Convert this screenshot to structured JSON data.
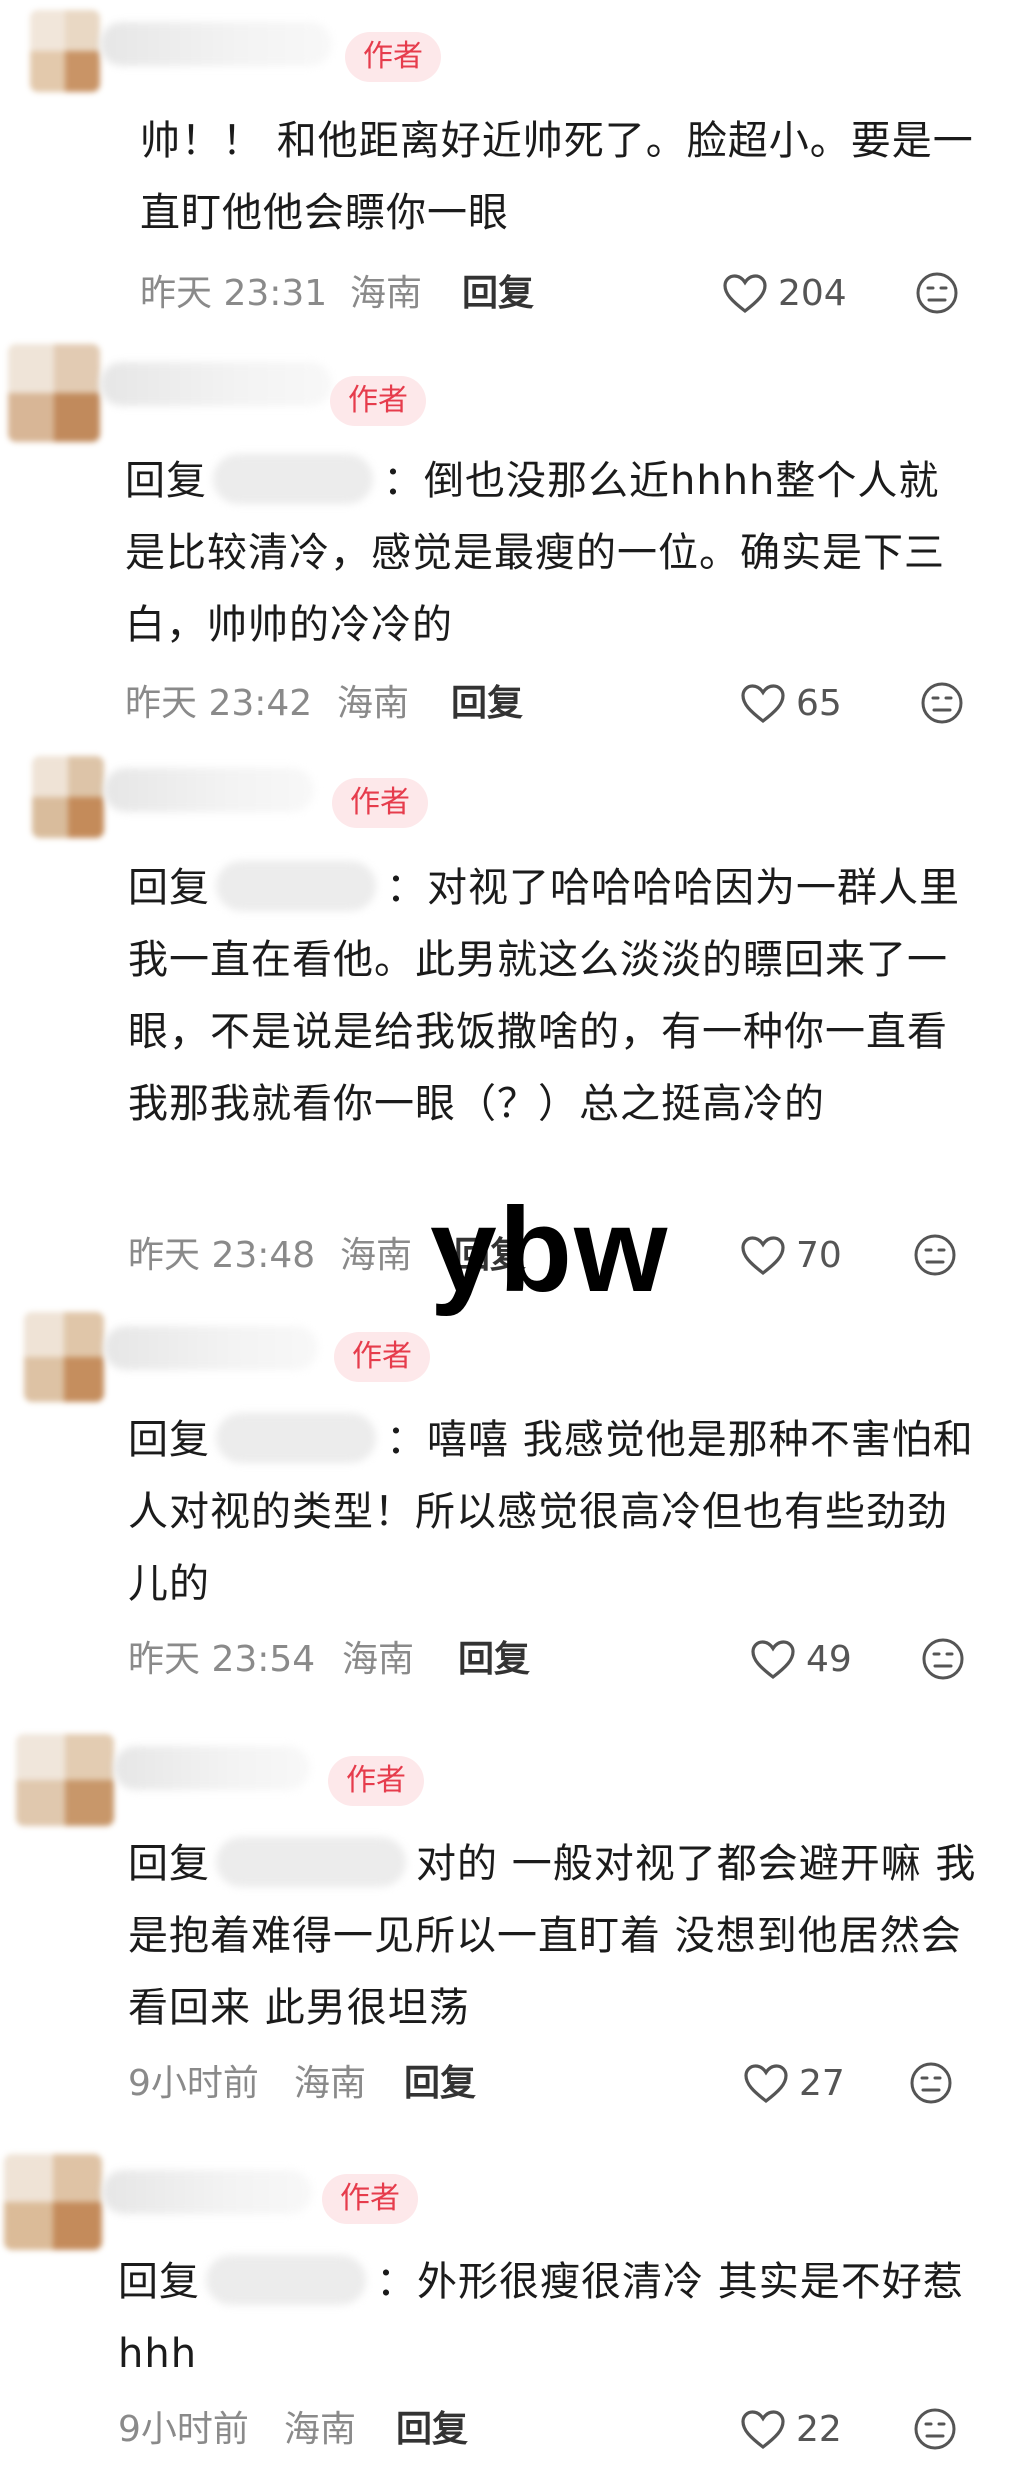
{
  "author_badge": "作者",
  "reply_button": "回复",
  "watermark": "ybw",
  "comments": [
    {
      "text": "帅！！ 和他距离好近帅死了。脸超小。要是一直盯他他会瞟你一眼",
      "time": "昨天 23:31",
      "location": "海南",
      "likes": "204"
    },
    {
      "reply_label": "回复",
      "text": "：倒也没那么近hhhh整个人就是比较清冷，感觉是最瘦的一位。确实是下三白，帅帅的冷冷的",
      "time": "昨天 23:42",
      "location": "海南",
      "likes": "65"
    },
    {
      "reply_label": "回复",
      "text": "：对视了哈哈哈哈因为一群人里我一直在看他。此男就这么淡淡的瞟回来了一眼，不是说是给我饭撒啥的，有一种你一直看我那我就看你一眼（？）总之挺高冷的",
      "time": "昨天 23:48",
      "location": "海南",
      "likes": "70"
    },
    {
      "reply_label": "回复",
      "text": "：嘻嘻 我感觉他是那种不害怕和人对视的类型！所以感觉很高冷但也有些劲劲儿的",
      "time": "昨天 23:54",
      "location": "海南",
      "likes": "49"
    },
    {
      "reply_label": "回复",
      "text": "对的 一般对视了都会避开嘛 我是抱着难得一见所以一直盯着 没想到他居然会看回来 此男很坦荡",
      "time": "9小时前",
      "location": "海南",
      "likes": "27"
    },
    {
      "reply_label": "回复",
      "text": "：外形很瘦很清冷 其实是不好惹hhh",
      "time": "9小时前",
      "location": "海南",
      "likes": "22"
    }
  ]
}
